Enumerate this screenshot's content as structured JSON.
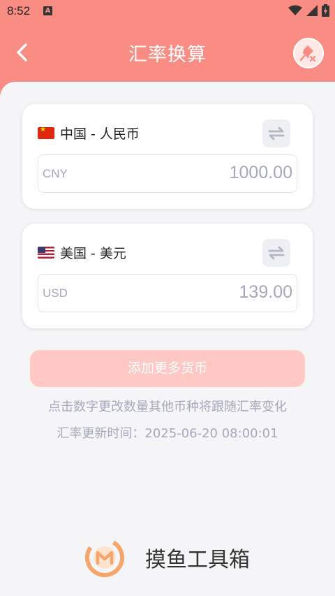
{
  "status_bar": {
    "time": "8:52",
    "app_icon": "A"
  },
  "header": {
    "title": "汇率换算",
    "back_icon": "chevron-left-icon",
    "pin_icon": "pin-off-icon"
  },
  "currencies": [
    {
      "flag": "cn-flag-icon",
      "name": "中国 - 人民币",
      "code": "CNY",
      "amount": "1000.00"
    },
    {
      "flag": "us-flag-icon",
      "name": "美国 - 美元",
      "code": "USD",
      "amount": "139.00"
    }
  ],
  "add_button": {
    "label": "添加更多货币"
  },
  "hint": "点击数字更改数量其他币种将跟随汇率变化",
  "updated": "汇率更新时间：2025-06-20 08:00:01",
  "brand": {
    "name": "摸鱼工具箱",
    "logo_letter": "M"
  },
  "colors": {
    "accent": "#f98c83",
    "add_button": "#ffc8c4",
    "muted_text": "#a6a8bb",
    "logo": "#f6a56b"
  }
}
